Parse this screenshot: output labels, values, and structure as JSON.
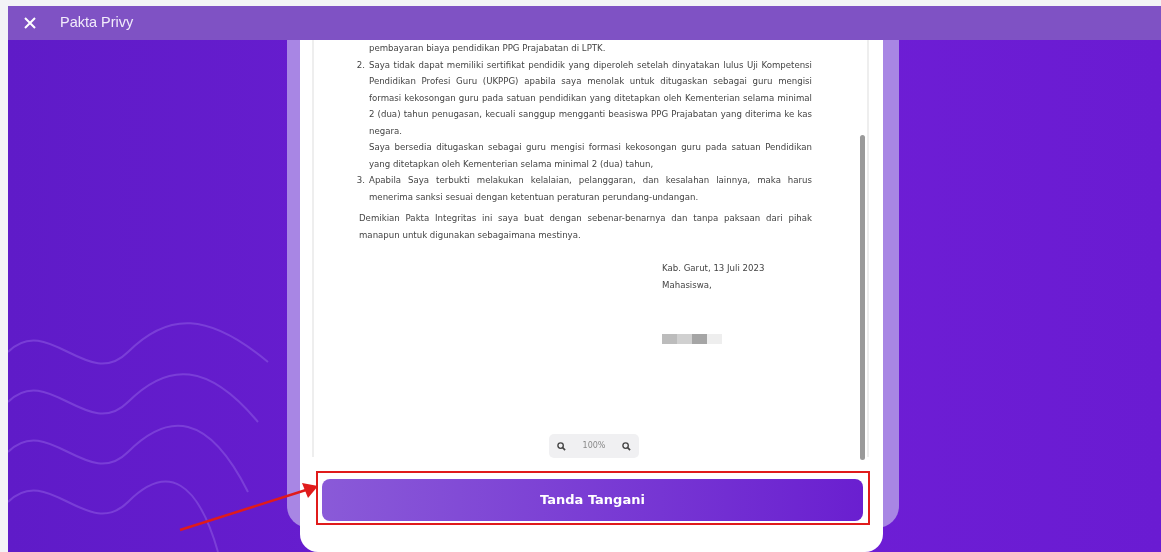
{
  "header": {
    "title": "Pakta Privy"
  },
  "document": {
    "items": [
      {
        "paragraphs": [
          "pembayaran biaya pendidikan PPG Prajabatan di LPTK."
        ]
      },
      {
        "number": "2.",
        "paragraphs": [
          "Saya tidak dapat memiliki sertifikat pendidik yang diperoleh setelah dinyatakan lulus Uji Kompetensi Pendidikan Profesi Guru (UKPPG) apabila saya menolak untuk ditugaskan sebagai guru mengisi formasi kekosongan guru pada satuan pendidikan yang ditetapkan oleh Kementerian selama minimal 2 (dua) tahun penugasan, kecuali sanggup mengganti beasiswa PPG Prajabatan yang diterima ke kas negara.",
          "Saya bersedia ditugaskan sebagai guru mengisi formasi kekosongan guru pada satuan Pendidikan yang ditetapkan oleh Kementerian selama minimal 2 (dua) tahun,"
        ]
      },
      {
        "number": "3.",
        "paragraphs": [
          "Apabila Saya terbukti melakukan kelalaian, pelanggaran, dan kesalahan lainnya, maka harus menerima sanksi sesuai dengan ketentuan peraturan perundang-undangan."
        ]
      }
    ],
    "closing": "Demikian Pakta Integritas ini saya buat dengan sebenar-benarnya dan tanpa paksaan dari pihak manapun untuk digunakan sebagaimana mestinya.",
    "place_date": "Kab. Garut, 13 Juli 2023",
    "signer_role": "Mahasiswa,"
  },
  "zoom": {
    "level_text": "100%"
  },
  "sign_button": {
    "label": "Tanda Tangani",
    "highlighted": true
  }
}
